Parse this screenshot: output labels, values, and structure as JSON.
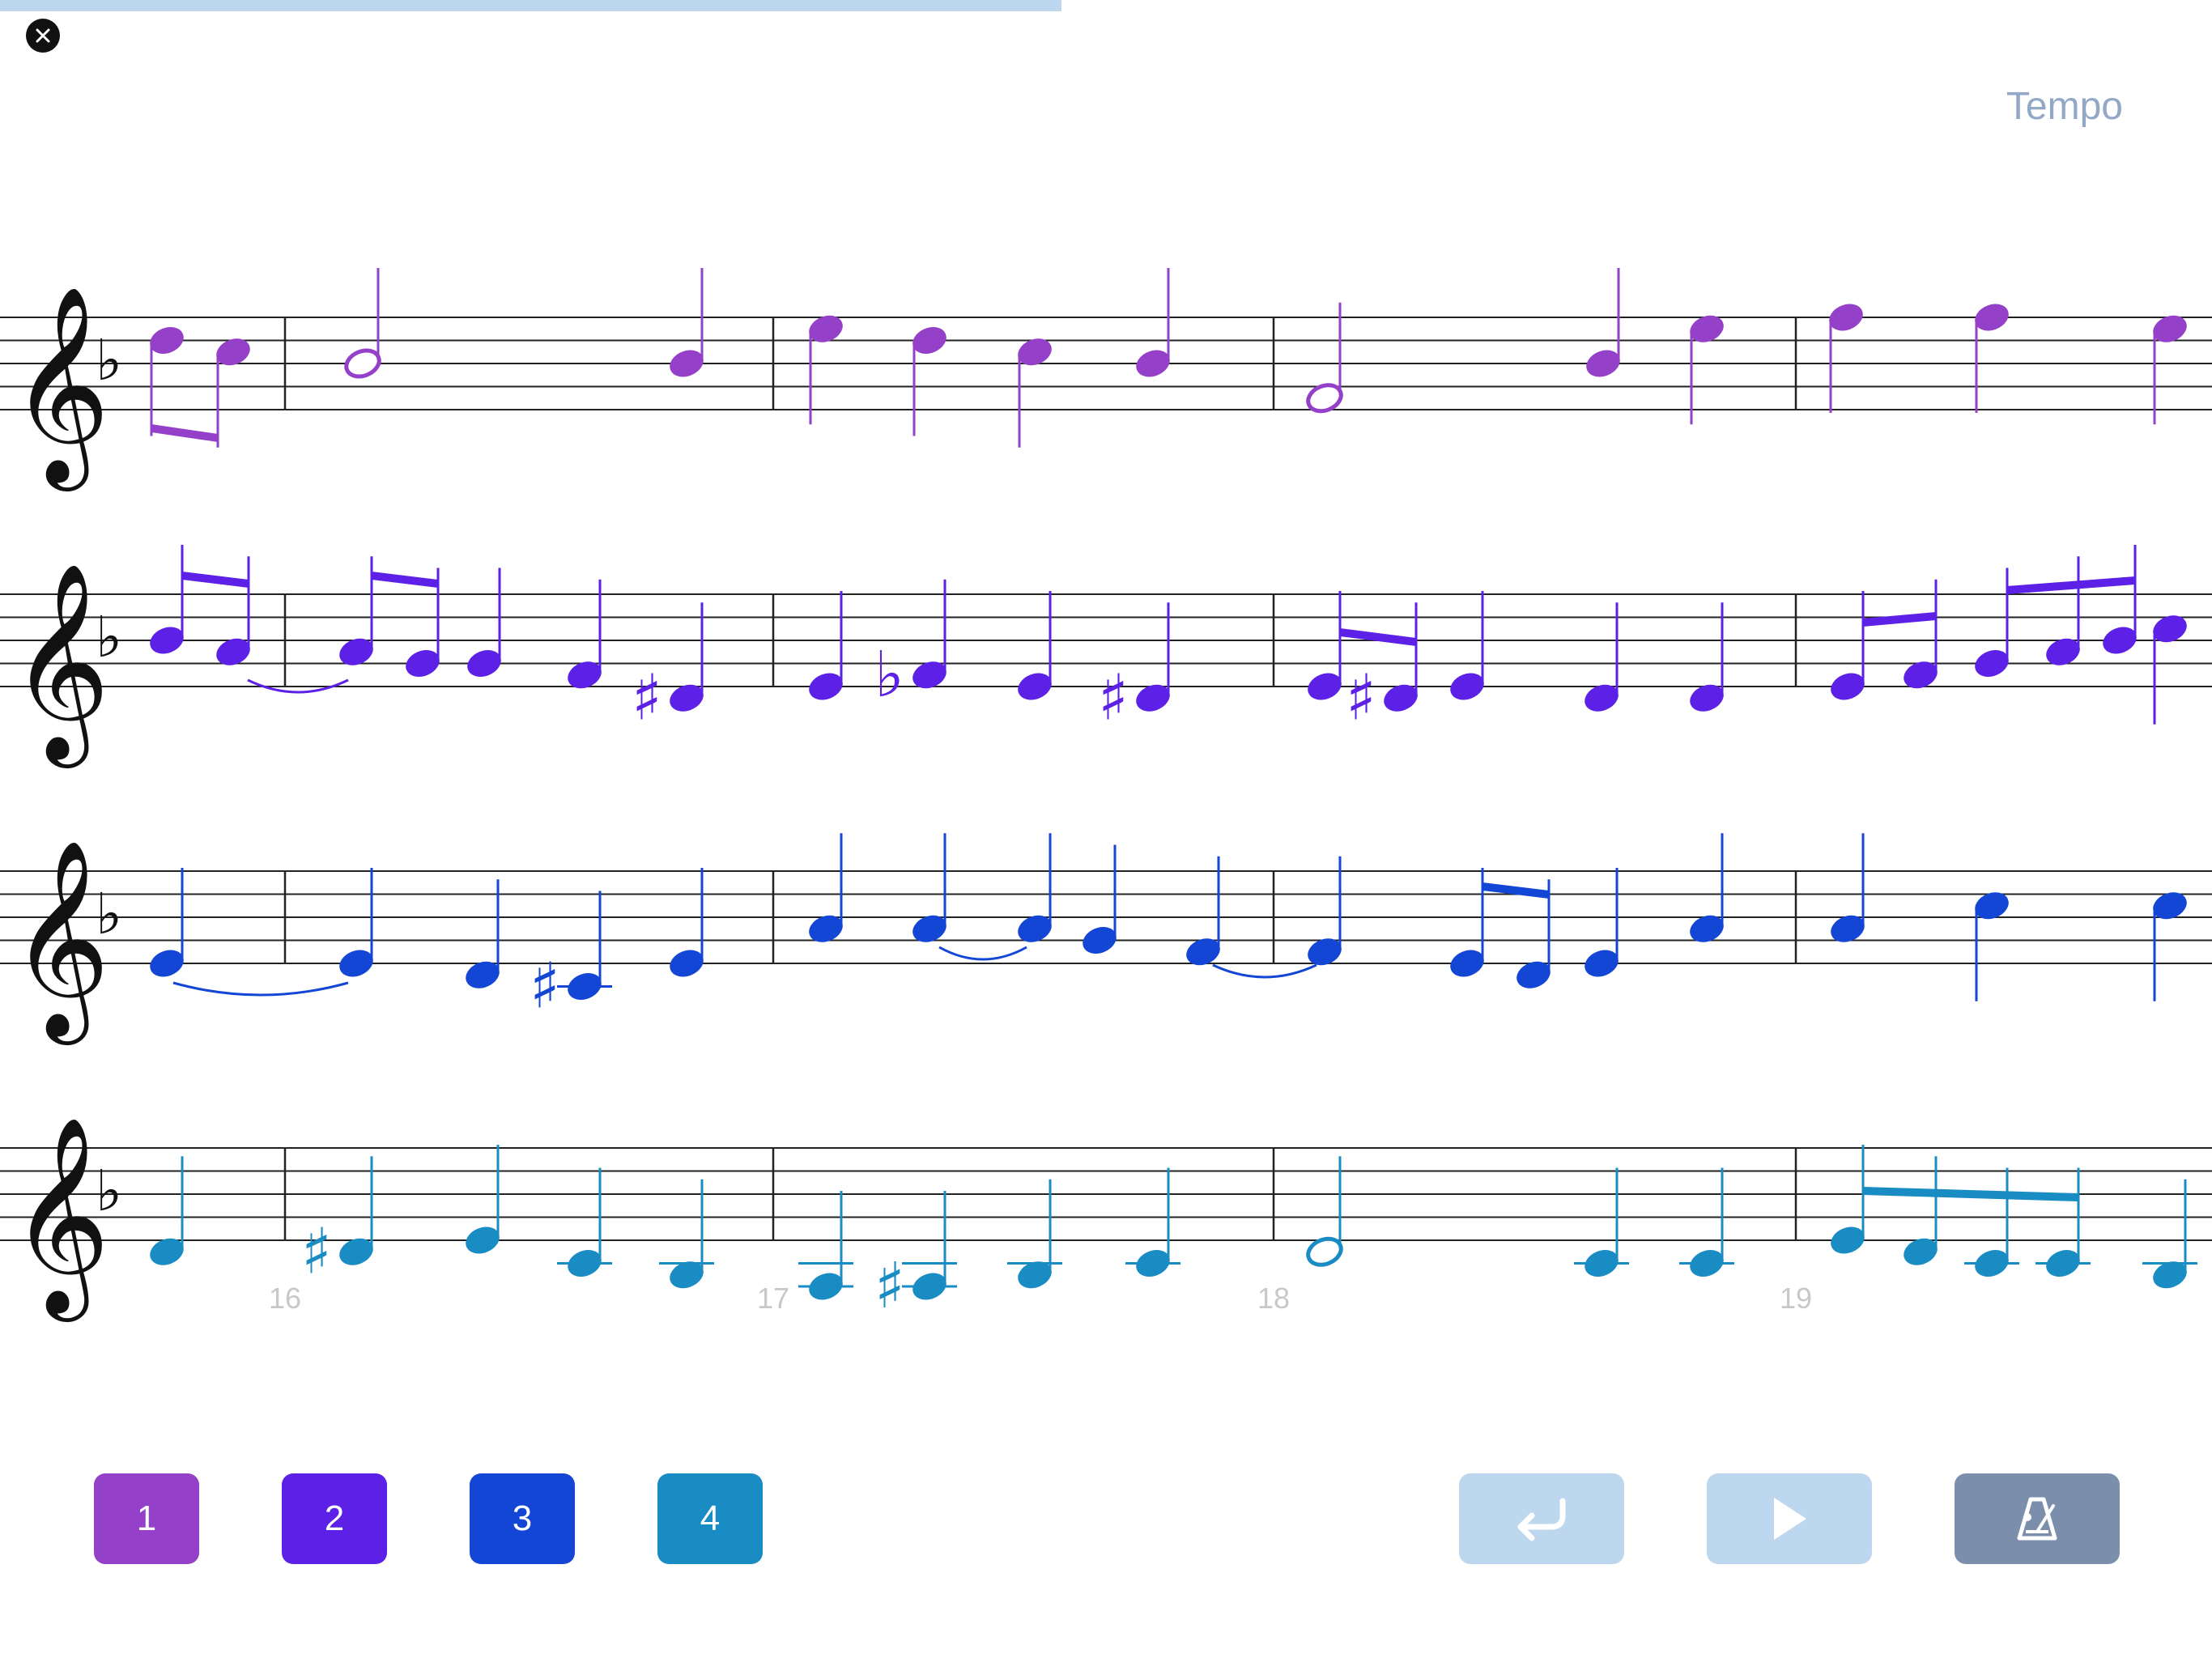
{
  "header": {
    "tempo_label": "Tempo",
    "close_icon": "close-icon",
    "progress_fraction": 0.48
  },
  "score": {
    "key_signature": "F major (one flat)",
    "clef": "treble",
    "measure_numbers": [
      "16",
      "17",
      "18",
      "19"
    ],
    "part_colors": [
      "#9440c8",
      "#5c20e6",
      "#1446d6",
      "#1a8cc4"
    ]
  },
  "parts": [
    {
      "label": "1",
      "color": "#9440c8"
    },
    {
      "label": "2",
      "color": "#5c20e6"
    },
    {
      "label": "3",
      "color": "#1446d6"
    },
    {
      "label": "4",
      "color": "#1a8cc4"
    }
  ],
  "controls": {
    "return_icon": "return-arrow-icon",
    "play_icon": "play-icon",
    "metronome_icon": "metronome-icon",
    "return_color": "#bcd7ee",
    "play_color": "#bcd7ee",
    "metronome_color": "#7b8fad"
  }
}
